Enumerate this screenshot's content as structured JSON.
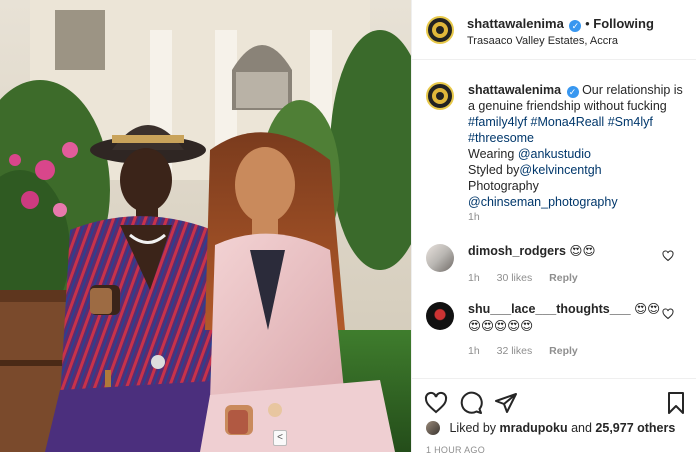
{
  "post": {
    "username": "shattawalenima",
    "follow_separator": "•",
    "follow_label": "Following",
    "location": "Trasaaco Valley Estates, Accra"
  },
  "caption": {
    "username": "shattawalenima",
    "text": "Our relationship is a genuine friendship without fucking",
    "hashtags": [
      "#family4lyf",
      "#Mona4Reall",
      "#Sm4lyf",
      "#threesome"
    ],
    "wearing_label": "Wearing",
    "wearing_tag": "@ankustudio",
    "styled_label": "Styled by",
    "styled_tag": "@kelvincentgh",
    "photo_label": "Photography",
    "photo_tag": "@chinseman_photography",
    "time": "1h"
  },
  "comments": [
    {
      "username": "dimosh_rodgers",
      "text": "😍😍",
      "time": "1h",
      "likes": "30 likes",
      "reply": "Reply"
    },
    {
      "username": "shu___lace___thoughts___",
      "text": "😍😍",
      "text2": "😍😍😍😍😍",
      "time": "1h",
      "likes": "32 likes",
      "reply": "Reply"
    }
  ],
  "liked_by": {
    "prefix": "Liked by",
    "user": "mradupoku",
    "and": "and",
    "others": "25,977 others"
  },
  "timestamp": "1 HOUR AGO",
  "edge_tab": "<",
  "colors": {
    "link": "#00376b",
    "verified": "#3897f0",
    "muted": "#8e8e8e",
    "text": "#262626"
  },
  "icons": {
    "like": "heart-icon",
    "comment": "comment-icon",
    "share": "share-icon",
    "save": "bookmark-icon",
    "verified": "verified-badge-icon"
  }
}
